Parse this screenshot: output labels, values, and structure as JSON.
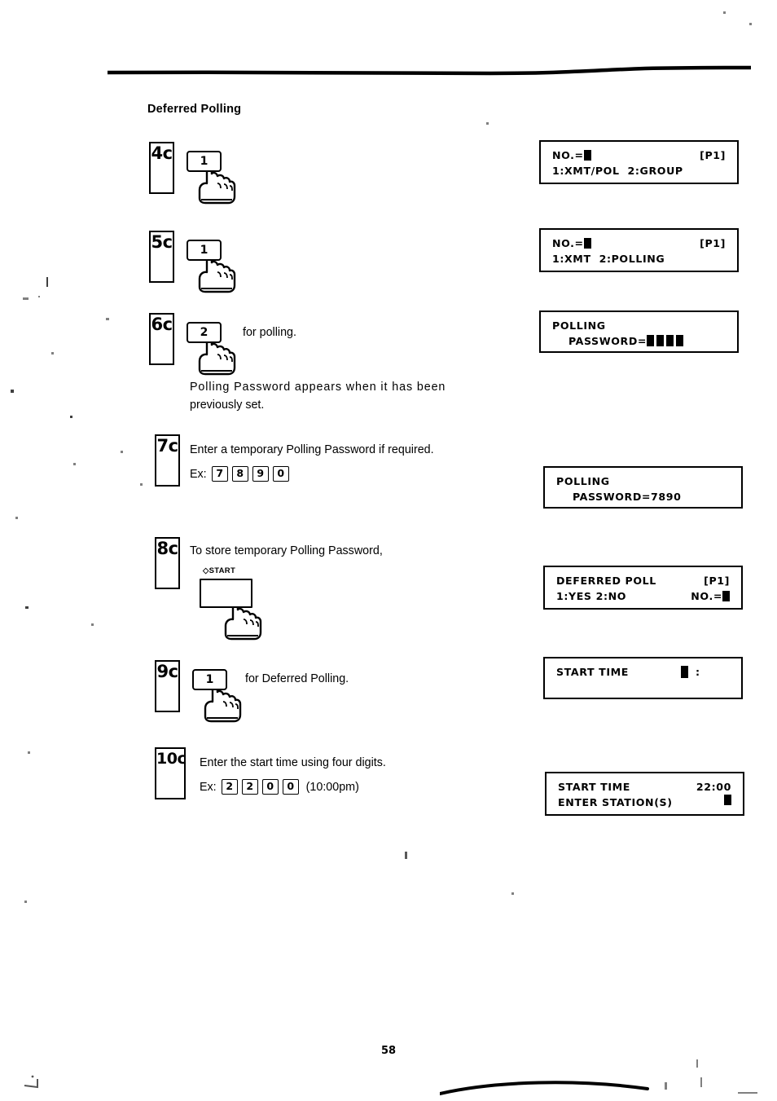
{
  "document": {
    "section_title": "Deferred Polling",
    "page_number": "58"
  },
  "steps": [
    {
      "id": "4c",
      "number": "4c",
      "key_label": "1",
      "instruction": "",
      "note": ""
    },
    {
      "id": "5c",
      "number": "5c",
      "key_label": "1",
      "instruction": "",
      "note": ""
    },
    {
      "id": "6c",
      "number": "6c",
      "key_label": "2",
      "instruction": "for polling.",
      "note_line1": "Polling Password appears when it has been",
      "note_line2": "previously set."
    },
    {
      "id": "7c",
      "number": "7c",
      "instruction": "Enter a temporary Polling Password if required.",
      "example_label": "Ex:",
      "example_keys": [
        "7",
        "8",
        "9",
        "0"
      ],
      "example_tail": ""
    },
    {
      "id": "8c",
      "number": "8c",
      "instruction": "To store temporary Polling Password,",
      "start_key_label": "START",
      "start_key_symbol": "◇"
    },
    {
      "id": "9c",
      "number": "9c",
      "key_label": "1",
      "instruction": "for Deferred Polling."
    },
    {
      "id": "10c",
      "number": "10c",
      "instruction": "Enter the start time using four digits.",
      "example_label": "Ex:",
      "example_keys": [
        "2",
        "2",
        "0",
        "0"
      ],
      "example_tail": "(10:00pm)"
    }
  ],
  "displays": [
    {
      "id": "display-1",
      "line1_left": "NO.=",
      "line1_cursor": true,
      "line1_right": "[P1]",
      "line2": "1:XMT/POL  2:GROUP"
    },
    {
      "id": "display-2",
      "line1_left": "NO.=",
      "line1_cursor": true,
      "line1_right": "[P1]",
      "line2": "1:XMT  2:POLLING"
    },
    {
      "id": "display-3",
      "line1": "POLLING",
      "line2_left": "    PASSWORD=",
      "line2_blocks": 4
    },
    {
      "id": "display-4",
      "line1": "POLLING",
      "line2": "    PASSWORD=7890"
    },
    {
      "id": "display-5",
      "line1_left": "DEFERRED POLL",
      "line1_right": "[P1]",
      "line2_left": "1:YES 2:NO",
      "line2_right": "NO.=",
      "line2_cursor": true
    },
    {
      "id": "display-6",
      "line1_left": "START TIME",
      "line1_cursor": true,
      "line1_right": ":",
      "line2": ""
    },
    {
      "id": "display-7",
      "line1_left": "START TIME",
      "line1_right": "22:00",
      "line2_left": "ENTER STATION(S)",
      "line2_cursor": true
    }
  ],
  "colors": {
    "ink": "#000000",
    "paper": "#ffffff"
  }
}
